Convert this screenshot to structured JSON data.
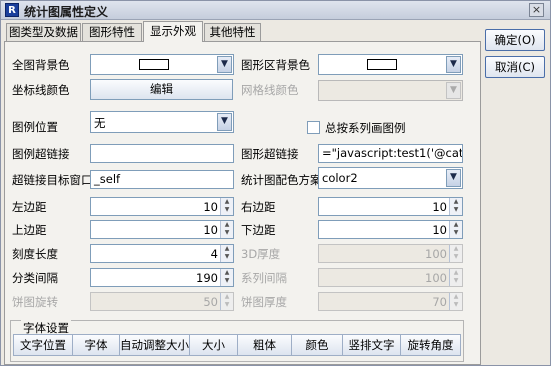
{
  "window": {
    "title": "统计图属性定义",
    "app_icon": "R",
    "close_glyph": "×"
  },
  "tabs": [
    {
      "label": "图类型及数据"
    },
    {
      "label": "图形特性"
    },
    {
      "label": "显示外观",
      "active": true
    },
    {
      "label": "其他特性"
    }
  ],
  "labels": {
    "full_bg": "全图背景色",
    "plot_bg": "图形区背景色",
    "axis_color": "坐标线颜色",
    "grid_color": "网格线颜色",
    "legend_pos": "图例位置",
    "legend_by_series": "总按系列画图例",
    "legend_link": "图例超链接",
    "chart_link": "图形超链接",
    "link_target": "超链接目标窗口",
    "color_scheme": "统计图配色方案",
    "left_margin": "左边距",
    "right_margin": "右边距",
    "top_margin": "上边距",
    "bottom_margin": "下边距",
    "tick_len": "刻度长度",
    "thickness_3d": "3D厚度",
    "category_gap": "分类间隔",
    "series_gap": "系列间隔",
    "pie_rotation": "饼图旋转",
    "pie_thickness": "饼图厚度"
  },
  "values": {
    "axis_color_button": "编辑",
    "legend_position": "无",
    "legend_link": "",
    "chart_link": "=\"javascript:test1('@category','",
    "link_target": "_self",
    "color_scheme": "color2",
    "left_margin": "10",
    "right_margin": "10",
    "top_margin": "10",
    "bottom_margin": "10",
    "tick_len": "4",
    "thickness_3d": "100",
    "category_gap": "190",
    "series_gap": "100",
    "pie_rotation": "50",
    "pie_thickness": "70"
  },
  "font_settings": {
    "title": "字体设置",
    "buttons": [
      "文字位置",
      "字体",
      "自动调整大小",
      "大小",
      "粗体",
      "颜色",
      "竖排文字",
      "旋转角度"
    ]
  },
  "buttons": {
    "ok": "确定(O)",
    "cancel": "取消(C)"
  },
  "colors": {
    "accent": "#7f9db9",
    "panel": "#f3f2ee",
    "window": "#ece9e2"
  }
}
